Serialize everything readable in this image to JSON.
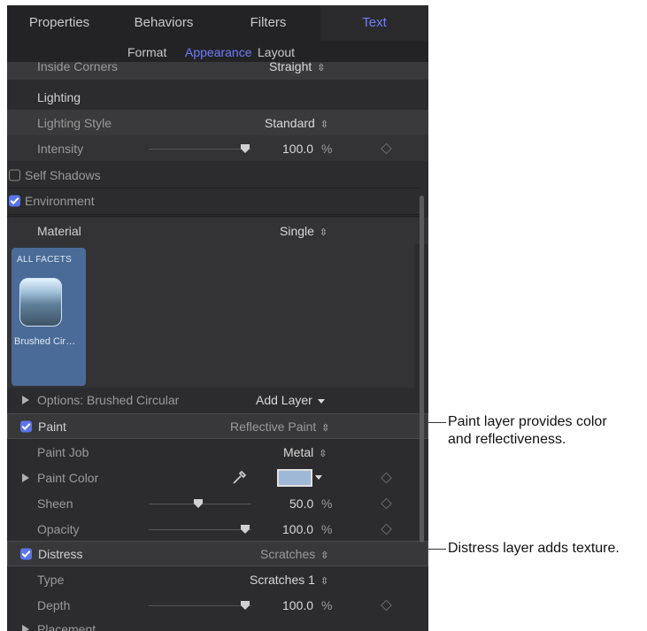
{
  "tabs": [
    {
      "label": "Properties",
      "active": false
    },
    {
      "label": "Behaviors",
      "active": false
    },
    {
      "label": "Filters",
      "active": false
    },
    {
      "label": "Text",
      "active": true
    }
  ],
  "subtabs": [
    {
      "label": "Format",
      "active": false
    },
    {
      "label": "Appearance",
      "active": true
    },
    {
      "label": "Layout",
      "active": false
    }
  ],
  "inside_corners": {
    "label": "Inside Corners",
    "value": "Straight"
  },
  "lighting": {
    "header": "Lighting",
    "style_label": "Lighting Style",
    "style_value": "Standard",
    "intensity_label": "Intensity",
    "intensity_value": "100.0",
    "intensity_unit": "%",
    "intensity_level": 1.0
  },
  "self_shadows": {
    "label": "Self Shadows",
    "checked": false
  },
  "environment": {
    "label": "Environment",
    "checked": true
  },
  "material": {
    "label": "Material",
    "value": "Single"
  },
  "facet": {
    "header": "ALL FACETS",
    "name": "Brushed Cir…"
  },
  "options": {
    "label": "Options: Brushed Circular",
    "add_layer": "Add Layer"
  },
  "paint": {
    "label": "Paint",
    "checked": true,
    "value": "Reflective Paint",
    "paint_job_label": "Paint Job",
    "paint_job_value": "Metal",
    "paint_color_label": "Paint Color",
    "paint_color": "#9fb8d6",
    "sheen_label": "Sheen",
    "sheen_value": "50.0",
    "sheen_unit": "%",
    "sheen_level": 0.5,
    "opacity_label": "Opacity",
    "opacity_value": "100.0",
    "opacity_unit": "%",
    "opacity_level": 1.0
  },
  "distress": {
    "label": "Distress",
    "checked": true,
    "value": "Scratches",
    "type_label": "Type",
    "type_value": "Scratches 1",
    "depth_label": "Depth",
    "depth_value": "100.0",
    "depth_unit": "%",
    "depth_level": 1.0
  },
  "placement": {
    "label": "Placement"
  },
  "callouts": {
    "paint_line1": "Paint layer provides color",
    "paint_line2": "and reflectiveness.",
    "distress": "Distress layer adds texture."
  },
  "colors": {
    "accent": "#6f7cff",
    "checkbox": "#5b74e8",
    "facet_bg": "#4a6b97"
  }
}
